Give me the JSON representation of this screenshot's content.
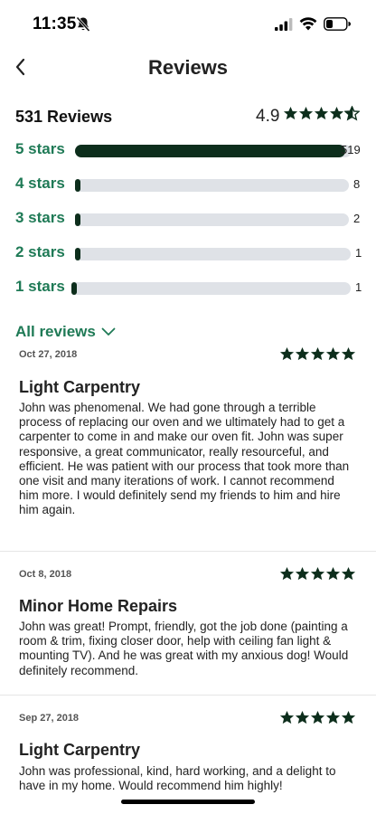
{
  "status_bar": {
    "time": "11:35"
  },
  "nav": {
    "title": "Reviews"
  },
  "summary": {
    "count_label": "531 Reviews",
    "rating": "4.9",
    "rating_value": 4.9
  },
  "distribution": [
    {
      "label": "5 stars",
      "count": "519",
      "fraction": 0.978
    },
    {
      "label": "4 stars",
      "count": "8",
      "fraction": 0.015
    },
    {
      "label": "3 stars",
      "count": "2",
      "fraction": 0.004
    },
    {
      "label": "2 stars",
      "count": "1",
      "fraction": 0.002
    },
    {
      "label": "1 stars",
      "count": "1",
      "fraction": 0.002
    }
  ],
  "all_reviews": {
    "label": "All reviews"
  },
  "reviews": [
    {
      "date": "Oct 27, 2018",
      "stars": 5,
      "title": "Light Carpentry",
      "body": "John was phenomenal. We had gone through a terrible process of replacing our oven and we ultimately had to get a carpenter to come in and make our oven fit. John was super responsive, a great communicator, really resourceful, and efficient. He was patient with our process that took more than one visit and many iterations of work. I cannot recommend him more. I would definitely send my friends to him and hire him again."
    },
    {
      "date": "Oct 8, 2018",
      "stars": 5,
      "title": "Minor Home Repairs",
      "body": "John was great! Prompt, friendly, got the job done (painting a room & trim, fixing closer door, help with ceiling fan light & mounting TV). And he was great with my anxious dog! Would definitely recommend."
    },
    {
      "date": "Sep 27, 2018",
      "stars": 5,
      "title": "Light Carpentry",
      "body": "John was professional, kind, hard working, and a delight to have in my home. Would recommend him highly!"
    }
  ],
  "colors": {
    "accent_green": "#1f7a56",
    "star_dark": "#0d2e1c",
    "bar_track": "#dfe2e7"
  }
}
